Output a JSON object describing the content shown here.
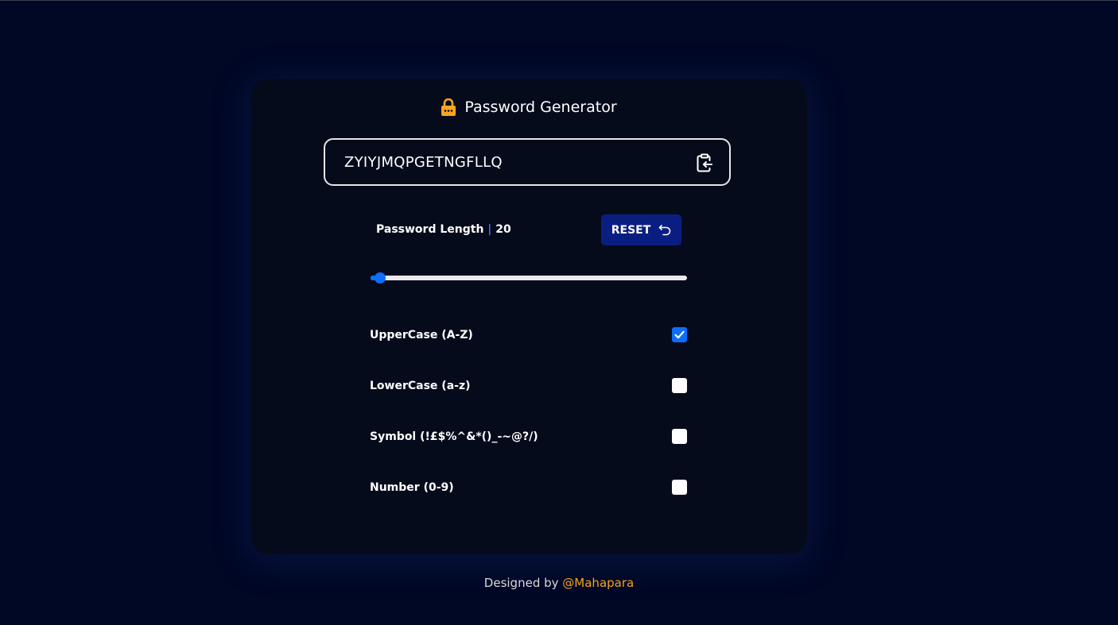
{
  "app": {
    "title": "Password Generator",
    "title_icon": "lock-icon"
  },
  "password": {
    "value": "ZYIYJMQPGETNGFLLQ",
    "copy_icon": "clipboard-copy-icon"
  },
  "length": {
    "label": "Password Length",
    "separator": "|",
    "value": "20",
    "slider_fraction": 0.03
  },
  "reset": {
    "label": "RESET",
    "icon": "undo-icon"
  },
  "options": [
    {
      "label": "UpperCase (A-Z)",
      "checked": true
    },
    {
      "label": "LowerCase (a-z)",
      "checked": false
    },
    {
      "label": "Symbol (!£$%^&*()_-~@?/)",
      "checked": false
    },
    {
      "label": "Number (0-9)",
      "checked": false
    }
  ],
  "footer": {
    "prefix": "Designed by",
    "author": "@Mahapara"
  },
  "colors": {
    "background": "#000826",
    "card": "#060b1c",
    "accent": "#0d6efd",
    "reset_button": "#0a1e82",
    "author_link": "#f0a31e",
    "lock": "#f5a623"
  }
}
